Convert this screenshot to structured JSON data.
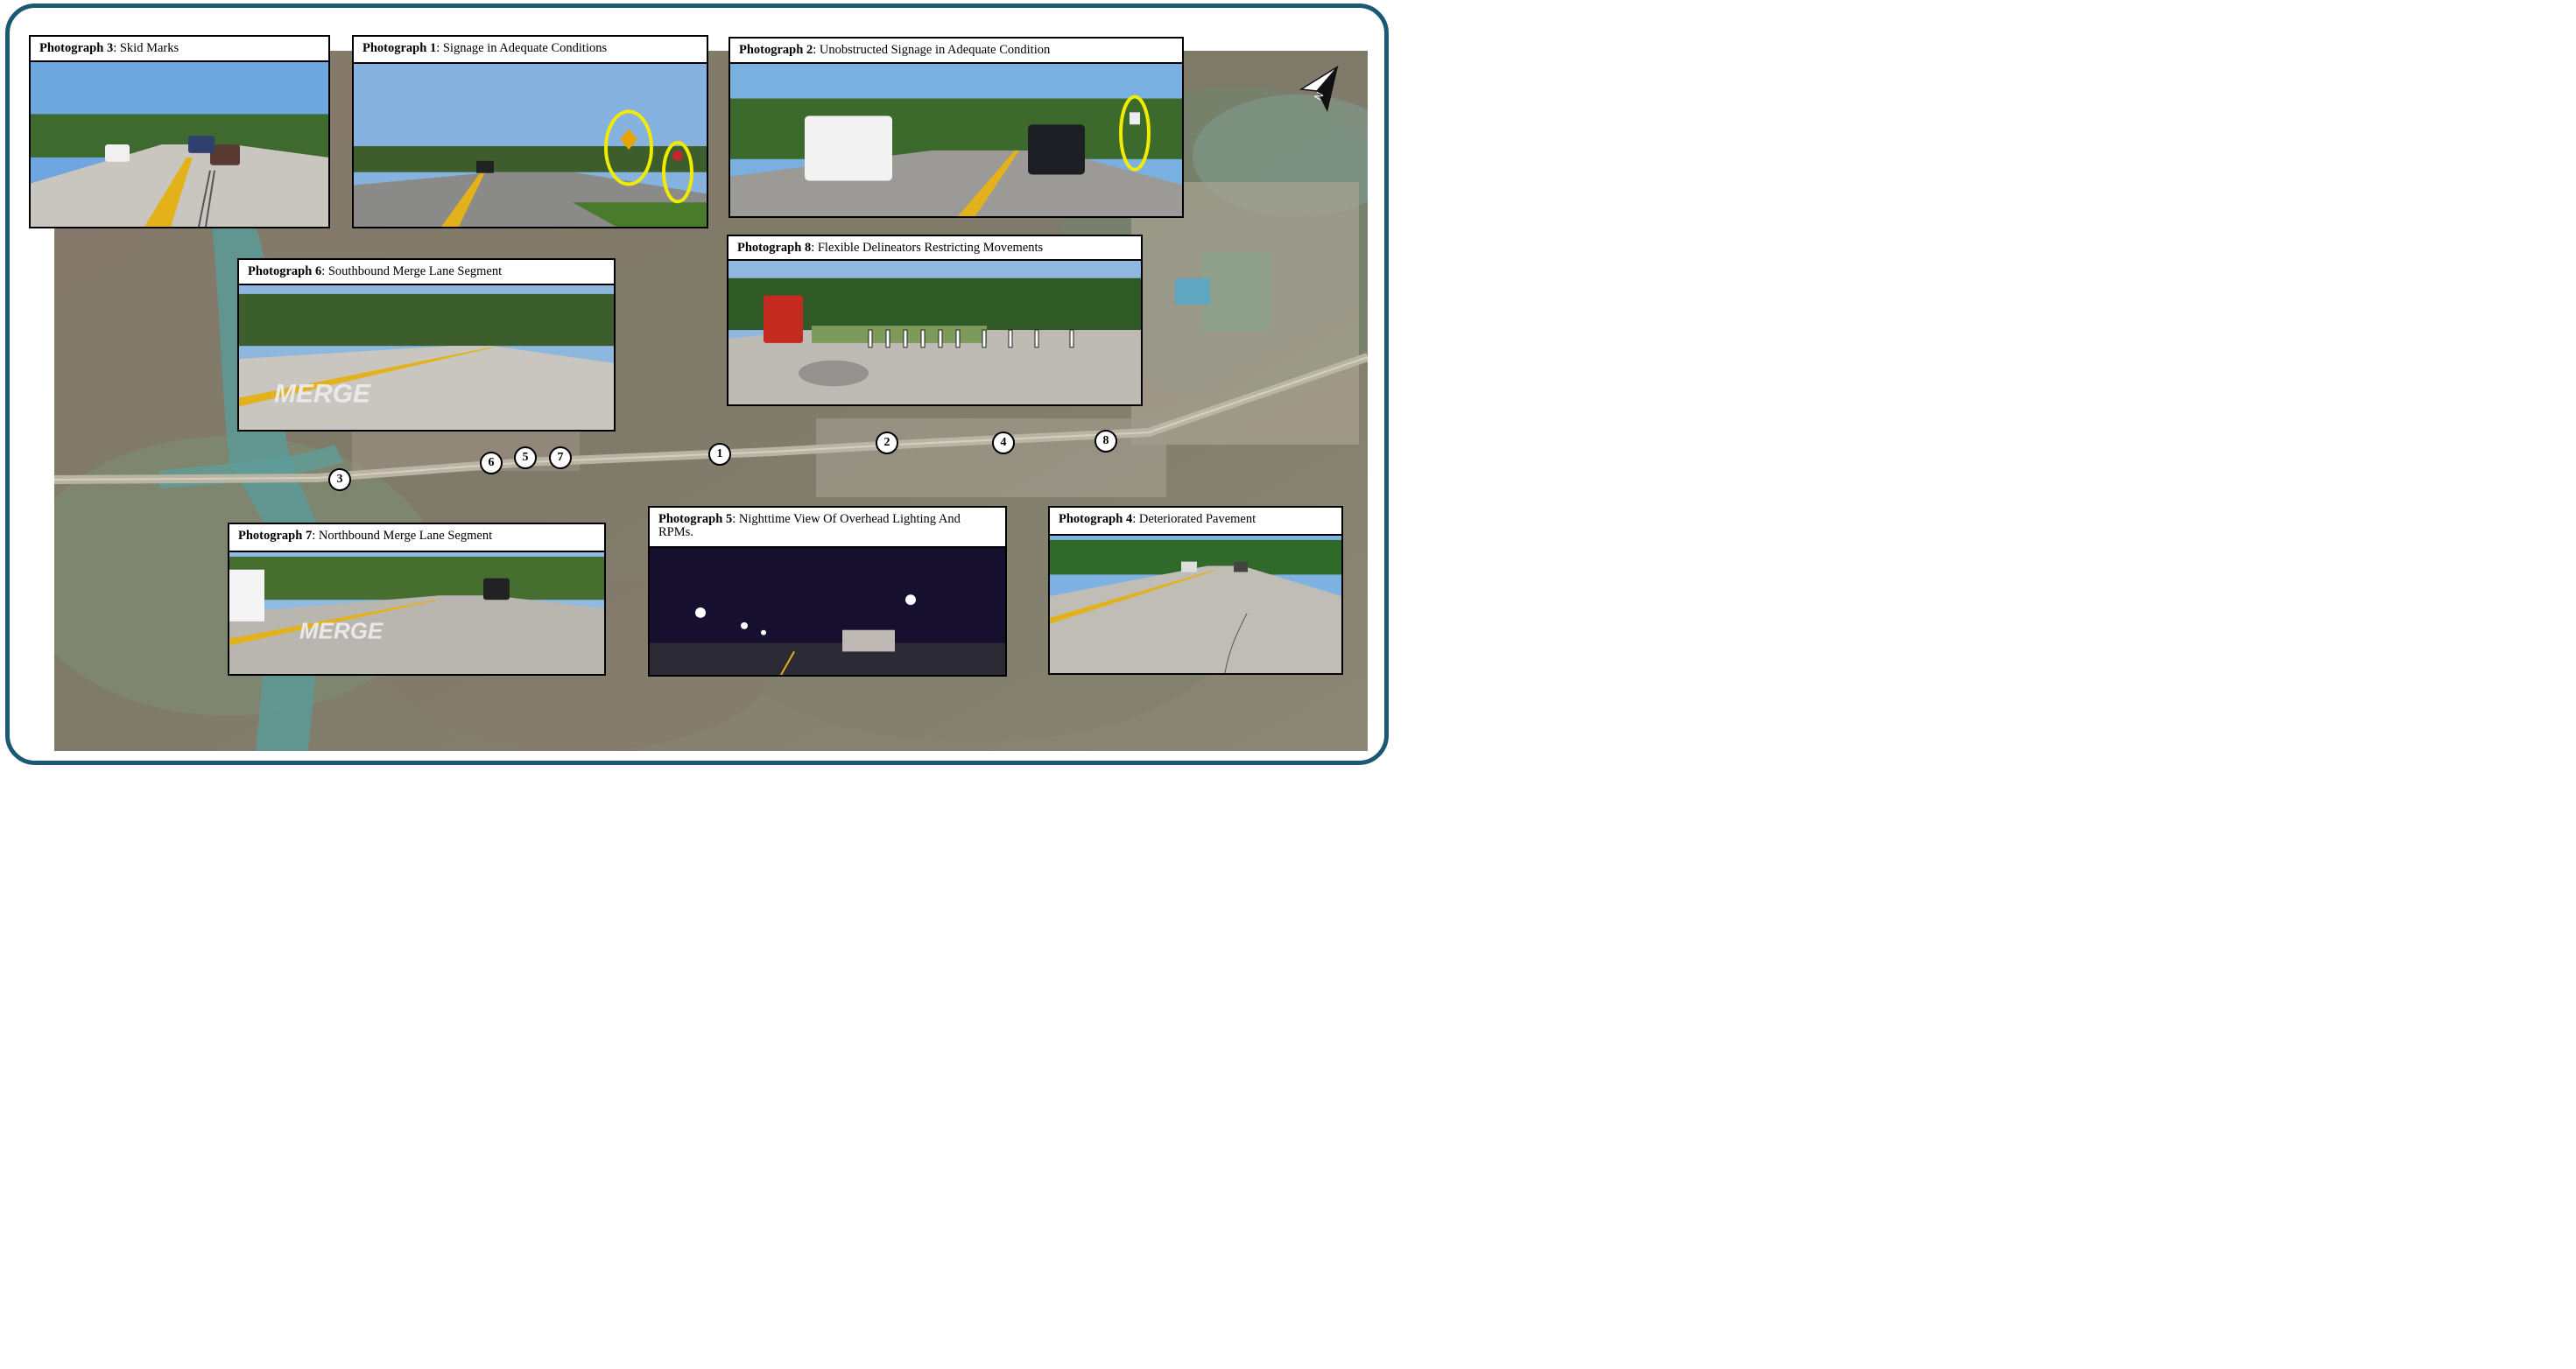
{
  "photos": {
    "p3": {
      "label": "Photograph 3",
      "desc": ": Skid Marks"
    },
    "p1": {
      "label": "Photograph 1",
      "desc": ": Signage in Adequate Conditions"
    },
    "p2": {
      "label": "Photograph 2",
      "desc": ": Unobstructed Signage in Adequate Condition"
    },
    "p8": {
      "label": "Photograph 8",
      "desc": ": Flexible Delineators Restricting Movements"
    },
    "p6": {
      "label": "Photograph 6",
      "desc": ": Southbound Merge Lane Segment"
    },
    "p7": {
      "label": "Photograph 7",
      "desc": ": Northbound Merge Lane Segment"
    },
    "p5": {
      "label": "Photograph 5",
      "desc": ": Nighttime View Of Overhead Lighting And RPMs."
    },
    "p4": {
      "label": "Photograph 4",
      "desc": ": Deteriorated Pavement"
    }
  },
  "pavement_text": {
    "p6": "MERGE",
    "p7": "MERGE"
  },
  "markers": [
    "1",
    "2",
    "3",
    "4",
    "5",
    "6",
    "7",
    "8"
  ],
  "north_arrow": {
    "label": "N",
    "icon": "north-arrow-icon"
  },
  "colors": {
    "frame": "#1d5873",
    "highlight": "#f2ea00",
    "road_line": "#e3b21a"
  }
}
